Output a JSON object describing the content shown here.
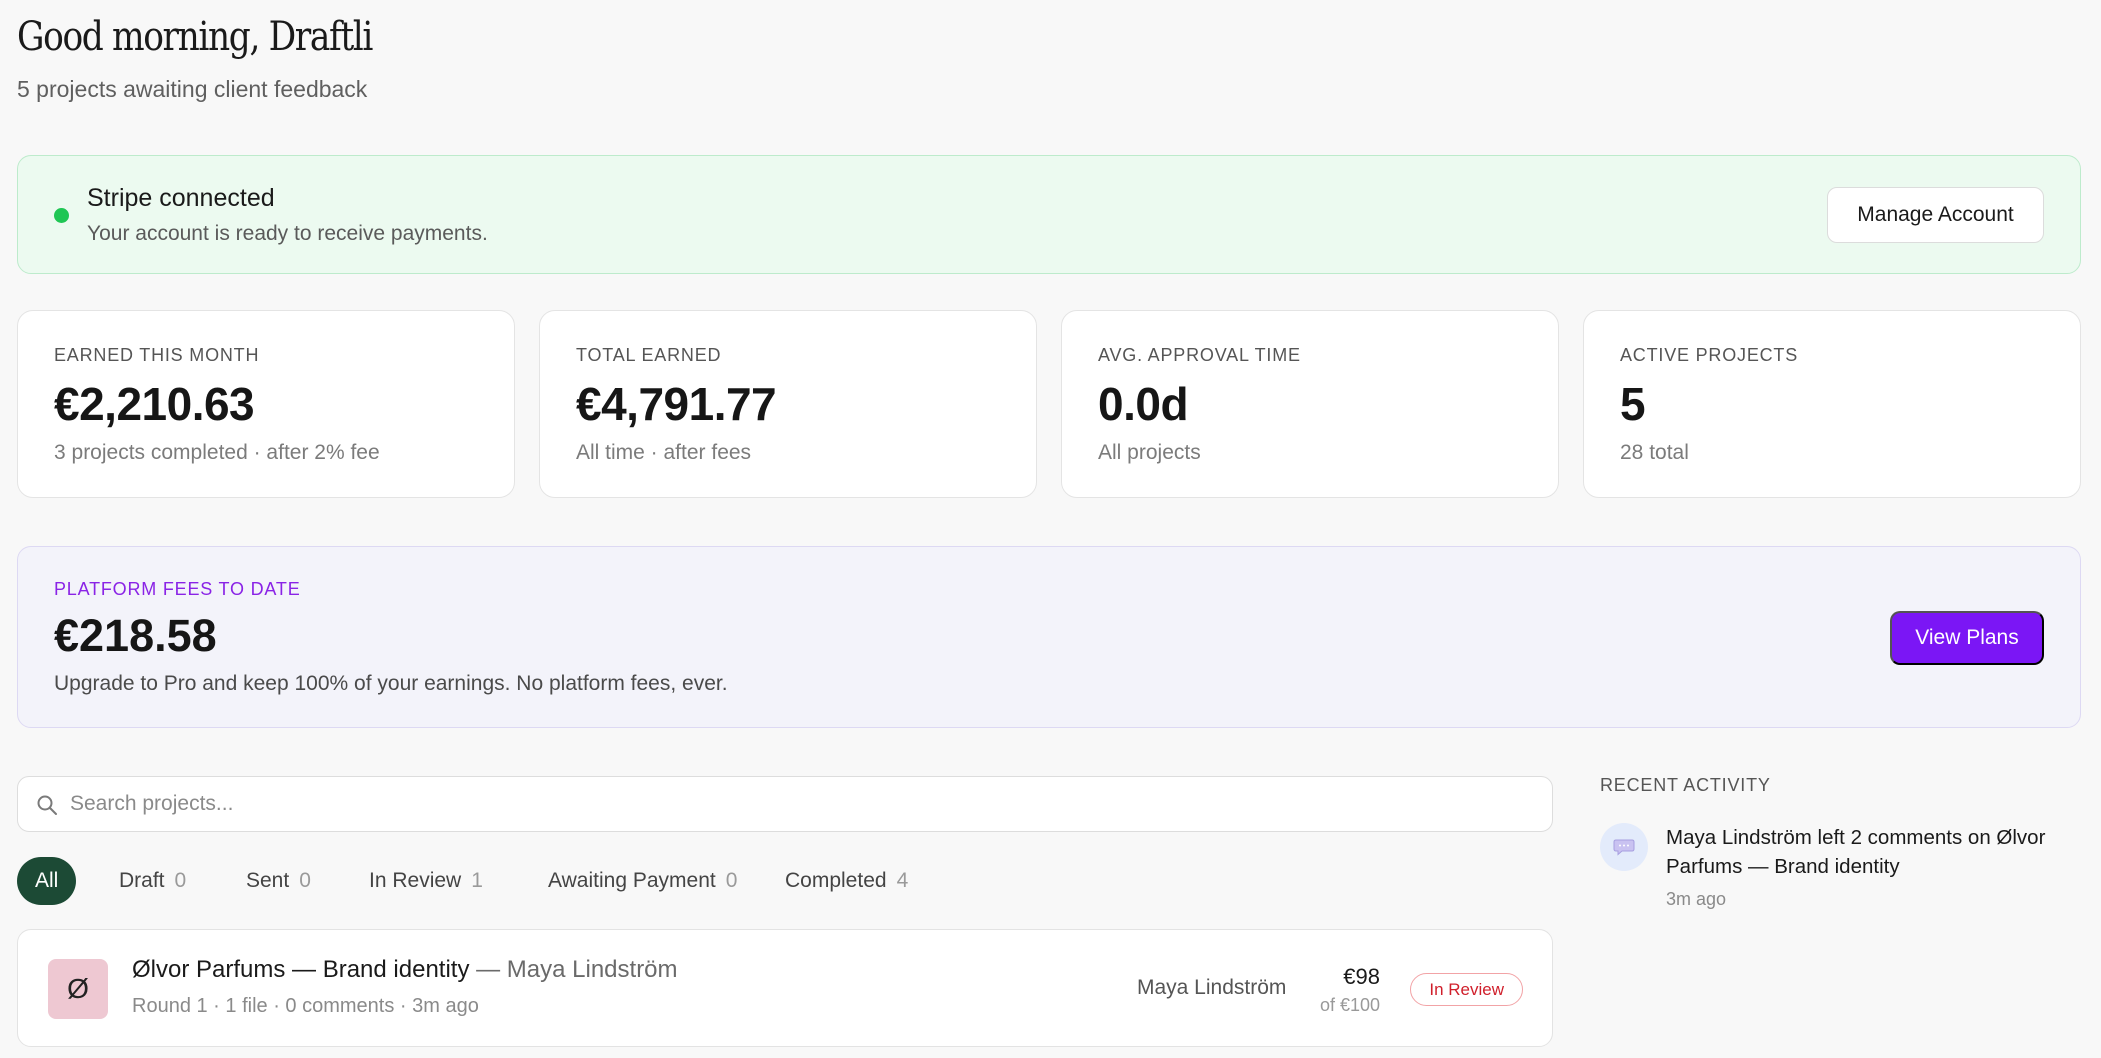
{
  "header": {
    "greeting": "Good morning, Draftli",
    "subtitle": "5 projects awaiting client feedback"
  },
  "stripe": {
    "title": "Stripe connected",
    "description": "Your account is ready to receive payments.",
    "button": "Manage Account",
    "status_color": "#1fc654"
  },
  "stats": [
    {
      "label": "EARNED THIS MONTH",
      "value": "€2,210.63",
      "sub": "3 projects completed · after 2% fee"
    },
    {
      "label": "TOTAL EARNED",
      "value": "€4,791.77",
      "sub": "All time · after fees"
    },
    {
      "label": "AVG. APPROVAL TIME",
      "value": "0.0d",
      "sub": "All projects"
    },
    {
      "label": "ACTIVE PROJECTS",
      "value": "5",
      "sub": "28 total"
    }
  ],
  "fees": {
    "label": "PLATFORM FEES TO DATE",
    "value": "€218.58",
    "description": "Upgrade to Pro and keep 100% of your earnings. No platform fees, ever.",
    "button": "View Plans",
    "accent": "#7b16f5"
  },
  "search": {
    "placeholder": "Search projects...",
    "value": ""
  },
  "filters": [
    {
      "label": "All",
      "count": ""
    },
    {
      "label": "Draft",
      "count": "0"
    },
    {
      "label": "Sent",
      "count": "0"
    },
    {
      "label": "In Review",
      "count": "1"
    },
    {
      "label": "Awaiting Payment",
      "count": "0"
    },
    {
      "label": "Completed",
      "count": "4"
    }
  ],
  "projects": [
    {
      "avatar": "Ø",
      "title": "Ølvor Parfums — Brand identity",
      "client_suffix": " — Maya Lindström",
      "meta": "Round 1 · 1 file · 0 comments · 3m ago",
      "person": "Maya Lindström",
      "amount": "€98",
      "of_amount": "of €100",
      "status": "In Review"
    }
  ],
  "activity": {
    "heading": "RECENT ACTIVITY",
    "items": [
      {
        "icon": "comment-icon",
        "text": "Maya Lindström left 2 comments on Ølvor Parfums — Brand identity",
        "time": "3m ago"
      }
    ]
  }
}
